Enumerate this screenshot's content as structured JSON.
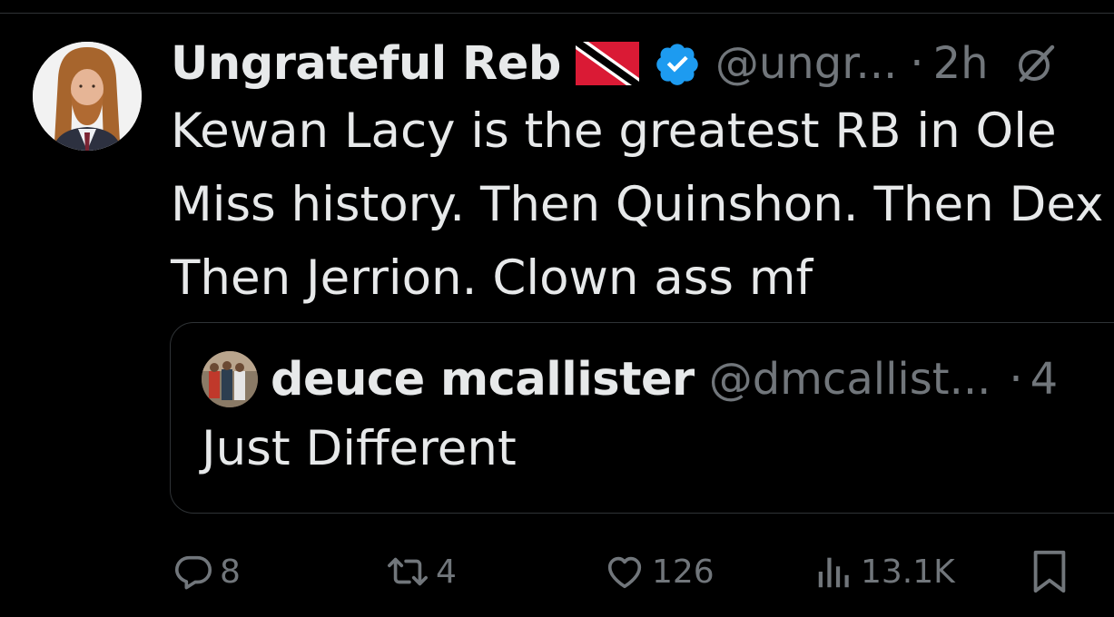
{
  "tweet": {
    "display_name": "Ungrateful Reb",
    "handle": "@ungr...",
    "separator": "·",
    "time": "2h",
    "text": "Kewan Lacy is the greatest RB in Ole\nMiss history. Then Quinshon. Then Dex\nThen Jerrion. Clown ass mf",
    "flag_icon": "trinidad-and-tobago-flag-icon",
    "verified_icon": "verified-badge-icon",
    "grok_icon": "grok-icon"
  },
  "quote": {
    "display_name": "deuce mcallister",
    "handle": "@dmcallist...",
    "separator": "·",
    "time": "4",
    "text": "Just Different"
  },
  "actions": {
    "replies": "8",
    "reposts": "4",
    "likes": "126",
    "views": "13.1K"
  },
  "colors": {
    "background": "#000000",
    "text": "#e7e9ea",
    "muted": "#71767b",
    "border": "#2f3336",
    "verified_blue": "#1d9bf0",
    "flag_red": "#da1a35"
  }
}
